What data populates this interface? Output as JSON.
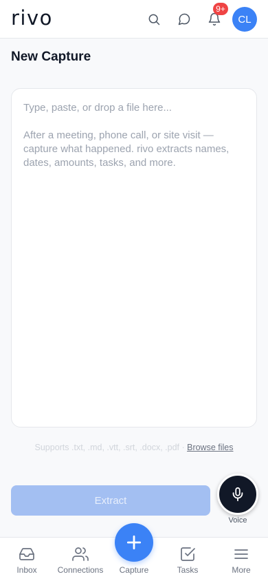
{
  "header": {
    "logo": "rivo",
    "notifications_badge": "9+",
    "avatar_initials": "CL",
    "icons": [
      "search-icon",
      "chat-icon",
      "bell-icon"
    ]
  },
  "page": {
    "title": "New Capture"
  },
  "capture": {
    "value": "",
    "placeholder": "Type, paste, or drop a file here...\n\nAfter a meeting, phone call, or site visit — capture what happened. rivo extracts names, dates, amounts, tasks, and more."
  },
  "supports": {
    "text": "Supports .txt, .md, .vtt, .srt, .docx, .pdf · ",
    "browse_label": "Browse files"
  },
  "actions": {
    "extract_label": "Extract",
    "voice_label": "Voice"
  },
  "nav": {
    "items": [
      {
        "label": "Inbox",
        "icon": "inbox-icon"
      },
      {
        "label": "Connections",
        "icon": "users-icon"
      },
      {
        "label": "Capture",
        "icon": "plus-icon"
      },
      {
        "label": "Tasks",
        "icon": "check-square-icon"
      },
      {
        "label": "More",
        "icon": "menu-icon"
      }
    ]
  },
  "colors": {
    "accent": "#3b82f6",
    "badge": "#ef4444",
    "extract_disabled": "#a3bff2",
    "voice_button": "#111827"
  }
}
